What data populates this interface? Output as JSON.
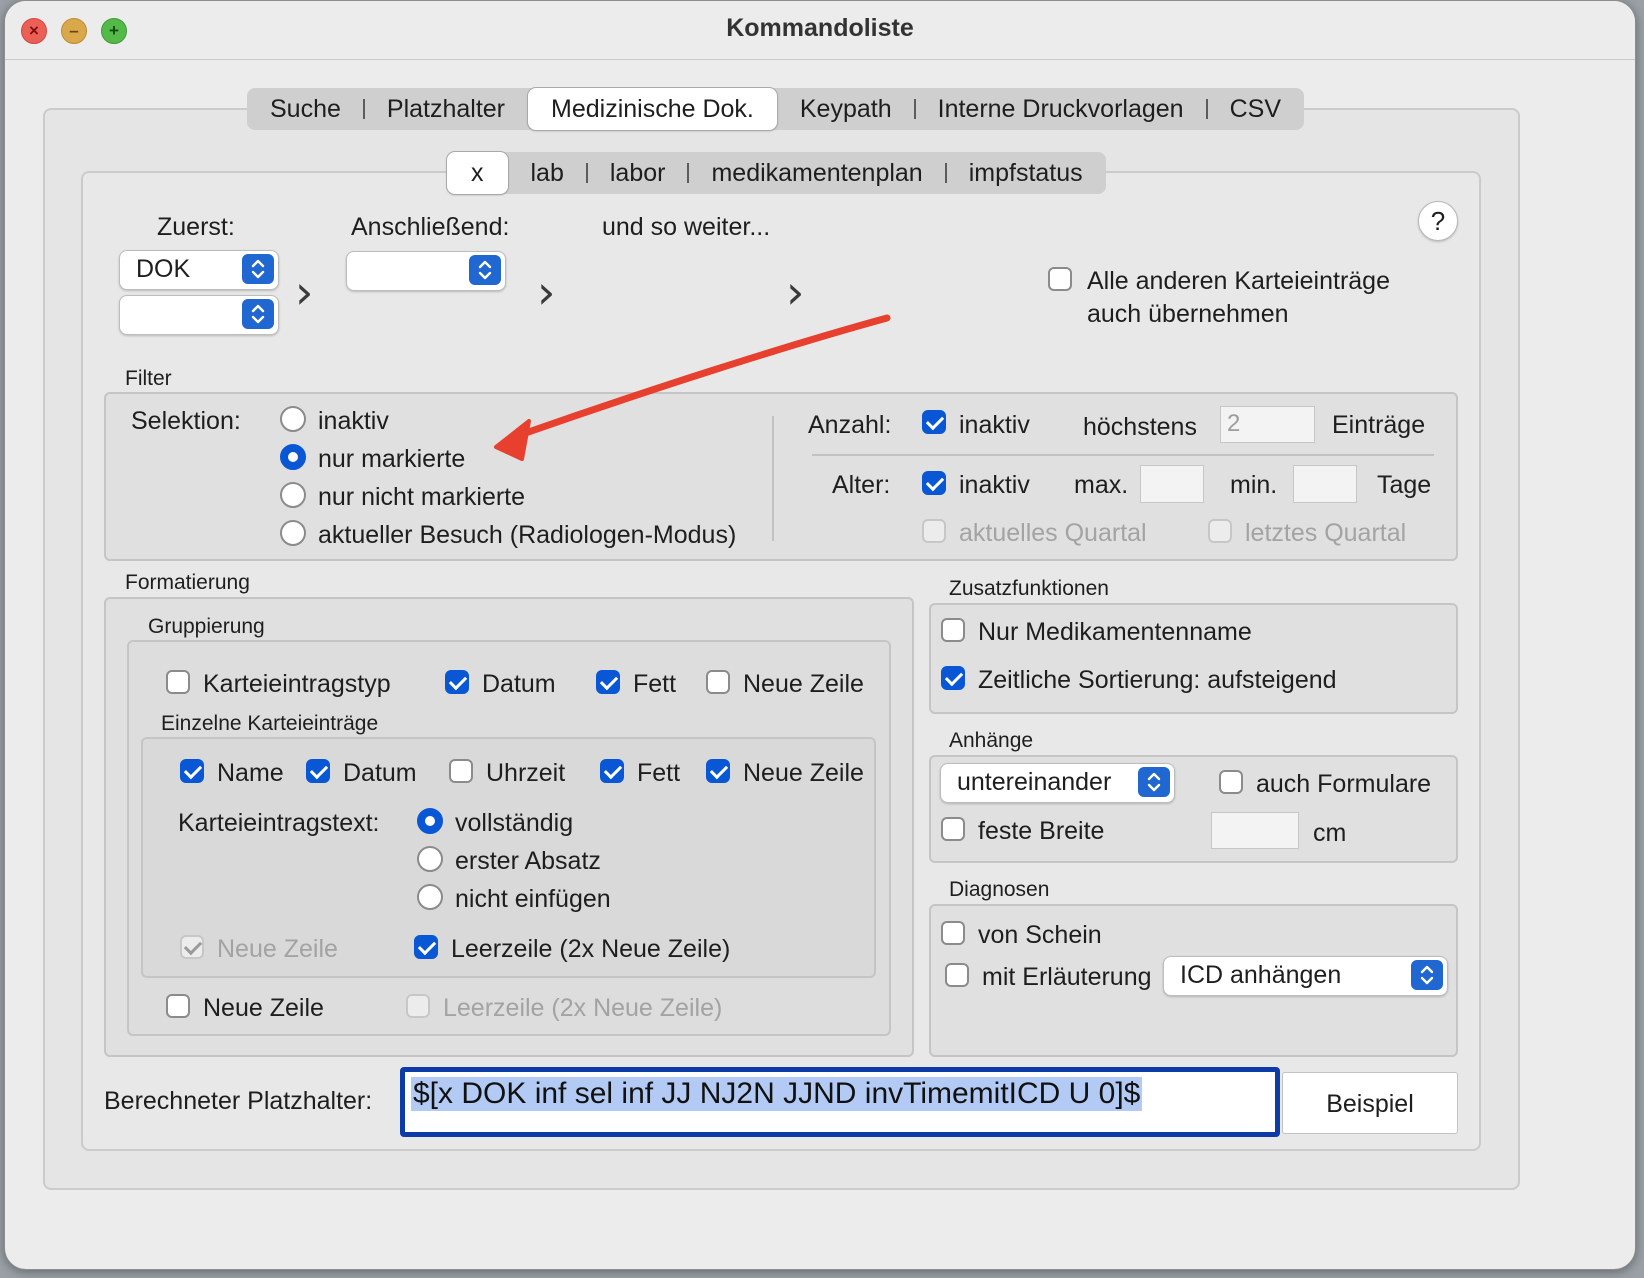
{
  "window": {
    "title": "Kommandoliste"
  },
  "main_tabs": [
    {
      "label": "Suche"
    },
    {
      "label": "Platzhalter"
    },
    {
      "label": "Medizinische Dok."
    },
    {
      "label": "Keypath"
    },
    {
      "label": "Interne Druckvorlagen"
    },
    {
      "label": "CSV"
    }
  ],
  "sub_tabs": [
    {
      "label": "x"
    },
    {
      "label": "lab"
    },
    {
      "label": "labor"
    },
    {
      "label": "medikamentenplan"
    },
    {
      "label": "impfstatus"
    }
  ],
  "order": {
    "first_label": "Zuerst:",
    "first_value": "DOK",
    "first_second_value": "",
    "then_label": "Anschließend:",
    "then_value": "",
    "etc_label": "und so weiter...",
    "help_label": "?",
    "take_others_label_1": "Alle anderen Karteieinträge",
    "take_others_label_2": "auch übernehmen",
    "take_others_checked": false
  },
  "filter": {
    "legend": "Filter",
    "selection_label": "Selektion:",
    "options": [
      "inaktiv",
      "nur markierte",
      "nur nicht markierte",
      "aktueller Besuch (Radiologen-Modus)"
    ],
    "selected": "nur markierte",
    "count_label": "Anzahl:",
    "count_inactive_label": "inaktiv",
    "count_inactive_checked": true,
    "max_label": "höchstens",
    "max_value": "2",
    "entries_label": "Einträge",
    "age_label": "Alter:",
    "age_inactive_label": "inaktiv",
    "age_inactive_checked": true,
    "age_max_label": "max.",
    "age_min_label": "min.",
    "days_label": "Tage",
    "current_quarter_label": "aktuelles Quartal",
    "last_quarter_label": "letztes Quartal"
  },
  "format": {
    "legend": "Formatierung",
    "grouping_legend": "Gruppierung",
    "grouping": [
      {
        "label": "Karteieintragstyp",
        "checked": false
      },
      {
        "label": "Datum",
        "checked": true
      },
      {
        "label": "Fett",
        "checked": true
      },
      {
        "label": "Neue Zeile",
        "checked": false
      }
    ],
    "single_legend": "Einzelne Karteieinträge",
    "single": [
      {
        "label": "Name",
        "checked": true
      },
      {
        "label": "Datum",
        "checked": true
      },
      {
        "label": "Uhrzeit",
        "checked": false
      },
      {
        "label": "Fett",
        "checked": true
      },
      {
        "label": "Neue Zeile",
        "checked": true
      }
    ],
    "text_label": "Karteieintragstext:",
    "text_options": [
      "vollständig",
      "erster Absatz",
      "nicht einfügen"
    ],
    "text_selected": "vollständig",
    "single_newline_label": "Neue Zeile",
    "single_newline_checked": true,
    "single_blank_label": "Leerzeile (2x Neue Zeile)",
    "single_blank_checked": true,
    "group_newline_label": "Neue Zeile",
    "group_newline_checked": false,
    "group_blank_label": "Leerzeile (2x Neue Zeile)",
    "group_blank_checked": false
  },
  "extras": {
    "legend": "Zusatzfunktionen",
    "med_name_label": "Nur Medikamentenname",
    "med_name_checked": false,
    "sort_label": "Zeitliche Sortierung: aufsteigend",
    "sort_checked": true
  },
  "attachments": {
    "legend": "Anhänge",
    "layout_value": "untereinander",
    "forms_label": "auch Formulare",
    "forms_checked": false,
    "fixed_width_label": "feste Breite",
    "fixed_width_checked": false,
    "unit_label": "cm"
  },
  "diagnoses": {
    "legend": "Diagnosen",
    "from_sheet_label": "von Schein",
    "from_sheet_checked": false,
    "explain_label": "mit Erläuterung",
    "explain_checked": false,
    "icd_value": "ICD anhängen"
  },
  "computed": {
    "label": "Berechneter Platzhalter:",
    "value": "$[x DOK inf sel inf JJ NJ2N JJND invTimemitICD U 0]$",
    "example_button": "Beispiel"
  },
  "colors": {
    "accent": "#0a57d6",
    "annotation_arrow": "#e8402f"
  }
}
